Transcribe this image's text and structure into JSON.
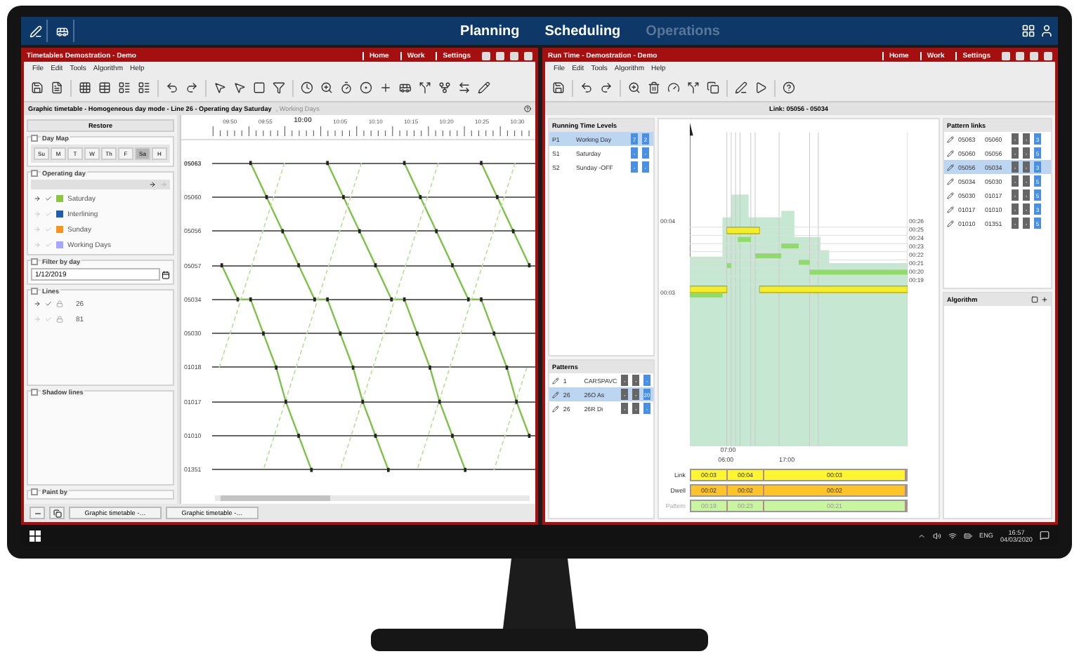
{
  "top_bar": {
    "nav": [
      {
        "label": "Planning",
        "disabled": false
      },
      {
        "label": "Scheduling",
        "disabled": false
      },
      {
        "label": "Operations",
        "disabled": true
      }
    ]
  },
  "timetable_window": {
    "title": "Timetables Demostration - Demo",
    "links": [
      "Home",
      "Work",
      "Settings"
    ],
    "menu": [
      "File",
      "Edit",
      "Tools",
      "Algorithm",
      "Help"
    ],
    "subtitle": "Graphic timetable - Homogeneous day mode - Line 26 - Operating day Saturday",
    "subtitle_faded": ", Working Days",
    "restore_button": "Restore",
    "day_map": {
      "title": "Day Map",
      "days": [
        {
          "label": "Su",
          "selected": false
        },
        {
          "label": "M",
          "selected": false
        },
        {
          "label": "T",
          "selected": false
        },
        {
          "label": "W",
          "selected": false
        },
        {
          "label": "Th",
          "selected": false
        },
        {
          "label": "F",
          "selected": false
        },
        {
          "label": "Sa",
          "selected": true
        },
        {
          "label": "H",
          "selected": false
        }
      ]
    },
    "operating_day": {
      "title": "Operating day",
      "items": [
        {
          "label": "Saturday",
          "color": "#8cc63f",
          "active": true
        },
        {
          "label": "Interlining",
          "color": "#1f5fad",
          "active": false
        },
        {
          "label": "Sunday",
          "color": "#f7941d",
          "active": false
        },
        {
          "label": "Working Days",
          "color": "#a6a6ff",
          "active": false
        }
      ]
    },
    "filter_by_day": {
      "title": "Filter by day",
      "value": "1/12/2019"
    },
    "lines": {
      "title": "Lines",
      "items": [
        {
          "label": "26",
          "active": true
        },
        {
          "label": "81",
          "active": false
        }
      ]
    },
    "shadow_lines": {
      "title": "Shadow lines"
    },
    "paint_by": {
      "title": "Paint by"
    },
    "time_ticks": [
      "09:50",
      "09:55",
      "10:00",
      "10:05",
      "10:10",
      "10:15",
      "10:20",
      "10:25",
      "10:30"
    ],
    "stations": [
      "05063",
      "05060",
      "05056",
      "05057",
      "05034",
      "05030",
      "01018",
      "01017",
      "01010",
      "01351"
    ],
    "tabs": [
      "Graphic timetable -…",
      "Graphic timetable -…"
    ]
  },
  "run_time_window": {
    "title": "Run Time - Demostration - Demo",
    "links": [
      "Home",
      "Work",
      "Settings"
    ],
    "menu": [
      "File",
      "Edit",
      "Tools",
      "Algorithm",
      "Help"
    ],
    "running_time_levels": {
      "title": "Running Time Levels",
      "rows": [
        {
          "code": "P1",
          "name": "Working Day",
          "selected": true,
          "values": [
            "7",
            "2"
          ]
        },
        {
          "code": "S1",
          "name": "Saturday",
          "selected": false,
          "values": [
            "-",
            "-"
          ]
        },
        {
          "code": "S2",
          "name": "Sunday -OFF",
          "selected": false,
          "values": [
            "-",
            "-"
          ]
        }
      ]
    },
    "patterns": {
      "title": "Patterns",
      "rows": [
        {
          "line": "1",
          "name": "CARSPAVC",
          "selected": false,
          "values": [
            "-",
            "-",
            "-"
          ]
        },
        {
          "line": "26",
          "name": "26O As",
          "selected": true,
          "values": [
            "-",
            "-",
            "20"
          ]
        },
        {
          "line": "26",
          "name": "26R Di",
          "selected": false,
          "values": [
            "-",
            "-",
            "-"
          ]
        }
      ]
    },
    "link_title": "Link: 05056 - 05034",
    "y_labels": [
      "00:04",
      "00:03"
    ],
    "right_labels": [
      "00:26",
      "00:25",
      "00:24",
      "00:23",
      "00:22",
      "00:21",
      "00:20",
      "00:19"
    ],
    "x_labels": [
      "07:00",
      "06:00",
      "17:00"
    ],
    "summary": [
      {
        "label": "Link",
        "kind": "link",
        "cells": [
          "00:03",
          "00:04",
          "00:03"
        ]
      },
      {
        "label": "Dwell",
        "kind": "dwell",
        "cells": [
          "00:02",
          "00:02",
          "00:02"
        ]
      },
      {
        "label": "Pattern",
        "kind": "pattern",
        "cells": [
          "00:19",
          "00:23",
          "00:21"
        ]
      }
    ],
    "pattern_links": {
      "title": "Pattern links",
      "rows": [
        {
          "from": "05063",
          "to": "05060",
          "selected": false,
          "values": [
            "-",
            "-",
            "3"
          ]
        },
        {
          "from": "05060",
          "to": "05056",
          "selected": false,
          "values": [
            "-",
            "-",
            "5"
          ]
        },
        {
          "from": "05056",
          "to": "05034",
          "selected": true,
          "values": [
            "-",
            "-",
            "3"
          ]
        },
        {
          "from": "05034",
          "to": "05030",
          "selected": false,
          "values": [
            "-",
            "-",
            "5"
          ]
        },
        {
          "from": "05030",
          "to": "01017",
          "selected": false,
          "values": [
            "-",
            "-",
            "5"
          ]
        },
        {
          "from": "01017",
          "to": "01010",
          "selected": false,
          "values": [
            "-",
            "-",
            "3"
          ]
        },
        {
          "from": "01010",
          "to": "01351",
          "selected": false,
          "values": [
            "-",
            "-",
            "5"
          ]
        }
      ]
    },
    "algorithm": {
      "title": "Algorithm"
    }
  },
  "taskbar": {
    "language": "ENG",
    "time": "16:57",
    "date": "04/03/2020"
  }
}
